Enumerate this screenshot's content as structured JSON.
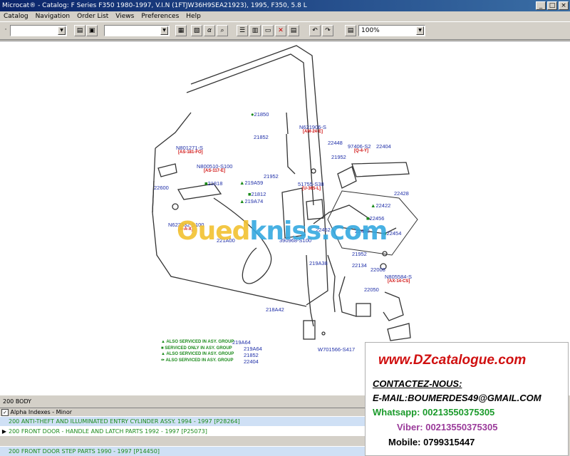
{
  "window": {
    "title": "Microcat® - Catalog: F Series F350 1980-1997, V.I.N (1FTJW36H9SEA21923), 1995, F350, 5.8 L",
    "buttons": {
      "minimize": "_",
      "maximize": "□",
      "close": "×"
    }
  },
  "menu": [
    "Catalog",
    "Navigation",
    "Order List",
    "Views",
    "Preferences",
    "Help"
  ],
  "toolbar": {
    "zoom": "100%"
  },
  "diagram": {
    "labels": [
      {
        "t": "21850",
        "c": "blue"
      },
      {
        "t": "21852",
        "c": "blue"
      },
      {
        "t": "N621906-S",
        "c": "blue"
      },
      {
        "t": "[AM-24-E]",
        "c": "red"
      },
      {
        "t": "22448",
        "c": "blue"
      },
      {
        "t": "N801271-S",
        "c": "blue"
      },
      {
        "t": "[AS-181-FO]",
        "c": "red"
      },
      {
        "t": "97406-S2",
        "c": "blue"
      },
      {
        "t": "22404",
        "c": "blue"
      },
      {
        "t": "[Q-4-Y]",
        "c": "red"
      },
      {
        "t": "21952",
        "c": "blue"
      },
      {
        "t": "N800510-S100",
        "c": "blue"
      },
      {
        "t": "[AS-117-E]",
        "c": "red"
      },
      {
        "t": "21952",
        "c": "blue"
      },
      {
        "t": "219A59",
        "c": "blue"
      },
      {
        "t": "21818",
        "c": "blue"
      },
      {
        "t": "22600",
        "c": "blue"
      },
      {
        "t": "51755-S38",
        "c": "blue"
      },
      {
        "t": "[U-365-L]",
        "c": "red"
      },
      {
        "t": "22428",
        "c": "blue"
      },
      {
        "t": "21812",
        "c": "blue"
      },
      {
        "t": "219A74",
        "c": "blue"
      },
      {
        "t": "22422",
        "c": "blue"
      },
      {
        "t": "22456",
        "c": "blue"
      },
      {
        "t": "N623332-S100",
        "c": "blue"
      },
      {
        "t": "[A-A-X]",
        "c": "red"
      },
      {
        "t": "22452",
        "c": "blue"
      },
      {
        "t": "22462",
        "c": "blue"
      },
      {
        "t": "22454",
        "c": "blue"
      },
      {
        "t": "221A00",
        "c": "blue"
      },
      {
        "t": "390968-S100",
        "c": "blue"
      },
      {
        "t": "21952",
        "c": "blue"
      },
      {
        "t": "22008",
        "c": "blue"
      },
      {
        "t": "219A38",
        "c": "blue"
      },
      {
        "t": "22134",
        "c": "blue"
      },
      {
        "t": "N805584-S",
        "c": "blue"
      },
      {
        "t": "[AX-14-CS]",
        "c": "red"
      },
      {
        "t": "22050",
        "c": "blue"
      },
      {
        "t": "218A42",
        "c": "blue"
      },
      {
        "t": "W701566-S417",
        "c": "blue"
      },
      {
        "t": "219A64",
        "c": "blue"
      },
      {
        "t": "219A64",
        "c": "blue"
      },
      {
        "t": "21852",
        "c": "blue"
      },
      {
        "t": "22404",
        "c": "blue"
      }
    ],
    "legend": [
      "▲ ALSO SERVICED IN ASY. GROUP",
      "■ SERVICED ONLY IN ASY. GROUP",
      "▲ ALSO SERVICED IN ASY. GROUP",
      "✑ ALSO SERVICED IN ASY. GROUP"
    ],
    "watermark": {
      "part1": "Oued",
      "part2": "kniss",
      "part3": ".com"
    }
  },
  "ad": {
    "site": "www.DZcatalogue.com",
    "contact": "CONTACTEZ-NOUS:",
    "email": "E-MAIL:BOUMERDES49@GMAIL.COM",
    "whatsapp": "Whatsapp: 00213550375305",
    "viber": "Viber: 00213550375305",
    "mobile": "Mobile: 0799315447"
  },
  "status": {
    "section": "200   BODY",
    "alpha_header": "Alpha Indexes - Minor",
    "rows": [
      {
        "marker": "",
        "text": "200  ANTI-THEFT AND ILLUMINATED ENTRY CYLINDER ASSY. 1994 - 1997 [P28264]"
      },
      {
        "marker": "▶",
        "text": "200  FRONT DOOR - HANDLE AND LATCH PARTS 1992 - 1997 [P25073]"
      },
      {
        "marker": "",
        "text": "200  FRONT DOOR STEP PARTS 1990 - 1997 [P14450]"
      }
    ]
  },
  "colors": {
    "title_bar": "#0a246a",
    "label_blue": "#1f2fa8",
    "label_red": "#d01010",
    "legend_green": "#1a8a1a",
    "ad_red": "#d01010",
    "ad_green": "#1a9a2a",
    "ad_purple": "#9a3a9a"
  }
}
